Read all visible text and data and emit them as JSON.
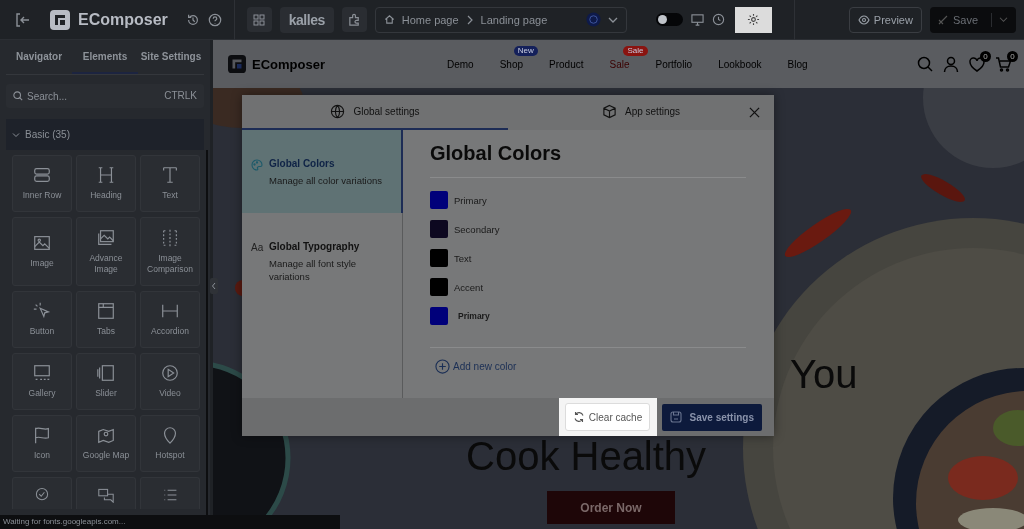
{
  "topbar": {
    "logo": "EComposer",
    "store": "kalles",
    "breadcrumb": [
      "Home page",
      "Landing page"
    ],
    "dark_mode": {
      "on": false
    },
    "preview": "Preview",
    "save": "Save"
  },
  "sidebar": {
    "tabs": [
      {
        "label": "Navigator",
        "selected": false
      },
      {
        "label": "Elements",
        "selected": true
      },
      {
        "label": "Site Settings",
        "selected": false
      }
    ],
    "search": {
      "placeholder": "Search...",
      "shortcut": "CTRLK"
    },
    "section": {
      "title": "Basic (35)",
      "expanded": true
    },
    "elements": [
      {
        "label": "Inner Row"
      },
      {
        "label": "Heading"
      },
      {
        "label": "Text"
      },
      {
        "label": "Image"
      },
      {
        "label": "Advance Image"
      },
      {
        "label": "Image Comparison"
      },
      {
        "label": "Button"
      },
      {
        "label": "Tabs"
      },
      {
        "label": "Accordion"
      },
      {
        "label": "Gallery"
      },
      {
        "label": "Slider"
      },
      {
        "label": "Video"
      },
      {
        "label": "Icon"
      },
      {
        "label": "Google Map"
      },
      {
        "label": "Hotspot"
      }
    ]
  },
  "site_nav": {
    "logo": "EComposer",
    "links": [
      {
        "label": "Demo",
        "highlighted": false
      },
      {
        "label": "Shop",
        "highlighted": false,
        "badge": {
          "text": "New",
          "color": "#14205a"
        }
      },
      {
        "label": "Product",
        "highlighted": false
      },
      {
        "label": "Sale",
        "highlighted": true,
        "badge": {
          "text": "Sale",
          "color": "#8a1410"
        }
      },
      {
        "label": "Portfolio",
        "highlighted": false
      },
      {
        "label": "Lookbook",
        "highlighted": false
      },
      {
        "label": "Blog",
        "highlighted": false
      }
    ],
    "wishlist_count": "0",
    "cart_count": "0"
  },
  "hero": {
    "heading_end": "You",
    "heading_line_2": "Cook Healthy",
    "button": "Order Now"
  },
  "modal": {
    "tabs": [
      {
        "label": "Global settings",
        "selected": true
      },
      {
        "label": "App settings",
        "selected": false
      }
    ],
    "menu": [
      {
        "title": "Global Colors",
        "description": "Manage all color variations",
        "selected": true
      },
      {
        "title": "Global Typography",
        "description": "Manage all font style variations",
        "selected": false,
        "glyph": "Aa"
      }
    ],
    "heading": "Global Colors",
    "colors": [
      {
        "name": "Primary",
        "color": "#00007a",
        "editing": false
      },
      {
        "name": "Secondary",
        "color": "#0d0820",
        "editing": false
      },
      {
        "name": "Text",
        "color": "#000000",
        "editing": false
      },
      {
        "name": "Accent",
        "color": "#000000",
        "editing": false
      },
      {
        "name": "Primary",
        "color": "#00007a",
        "editing": true
      }
    ],
    "add_color": "Add new color",
    "clear_cache": "Clear cache",
    "save": "Save settings"
  },
  "status_bar": "Waiting for fonts.googleapis.com..."
}
